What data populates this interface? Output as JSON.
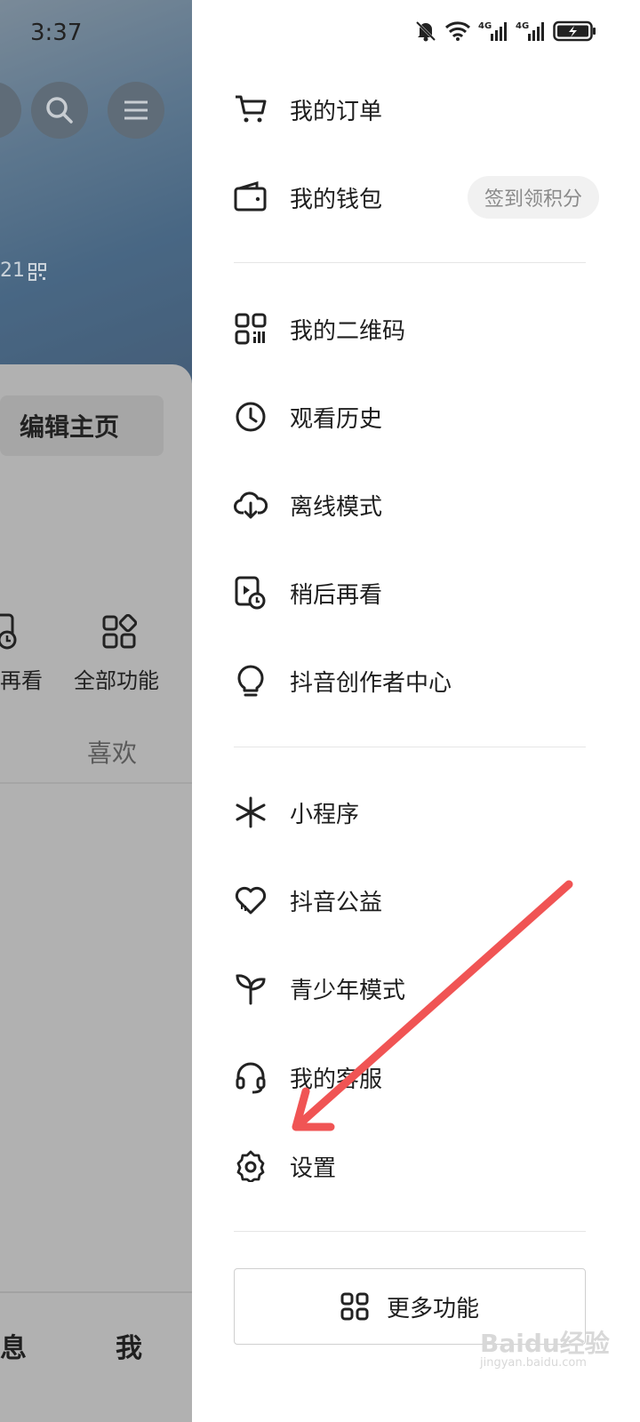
{
  "status_bar": {
    "time": "3:37"
  },
  "profile": {
    "hero_number": "21",
    "edit_button": "编辑主页",
    "shortcuts": [
      {
        "label": "再看",
        "icon": "watch-later-icon"
      },
      {
        "label": "全部功能",
        "icon": "grid-icon"
      }
    ],
    "tab_likes": "喜欢",
    "bottom_nav": {
      "messages": "消息",
      "me": "我"
    }
  },
  "drawer": {
    "items": [
      {
        "label": "我的订单",
        "icon": "cart-icon"
      },
      {
        "label": "我的钱包",
        "icon": "wallet-icon",
        "badge": "签到领积分"
      },
      {
        "label": "我的二维码",
        "icon": "qr-code-icon"
      },
      {
        "label": "观看历史",
        "icon": "clock-icon"
      },
      {
        "label": "离线模式",
        "icon": "cloud-download-icon"
      },
      {
        "label": "稍后再看",
        "icon": "watch-later-icon"
      },
      {
        "label": "抖音创作者中心",
        "icon": "lightbulb-icon"
      },
      {
        "label": "小程序",
        "icon": "mini-program-icon"
      },
      {
        "label": "抖音公益",
        "icon": "heart-icon"
      },
      {
        "label": "青少年模式",
        "icon": "sprout-icon"
      },
      {
        "label": "我的客服",
        "icon": "headset-icon"
      },
      {
        "label": "设置",
        "icon": "gear-icon"
      }
    ],
    "more_button": "更多功能"
  },
  "annotation": {
    "arrow_color": "#f05454"
  },
  "watermark": {
    "brand": "Baidu经验",
    "url": "jingyan.baidu.com"
  }
}
